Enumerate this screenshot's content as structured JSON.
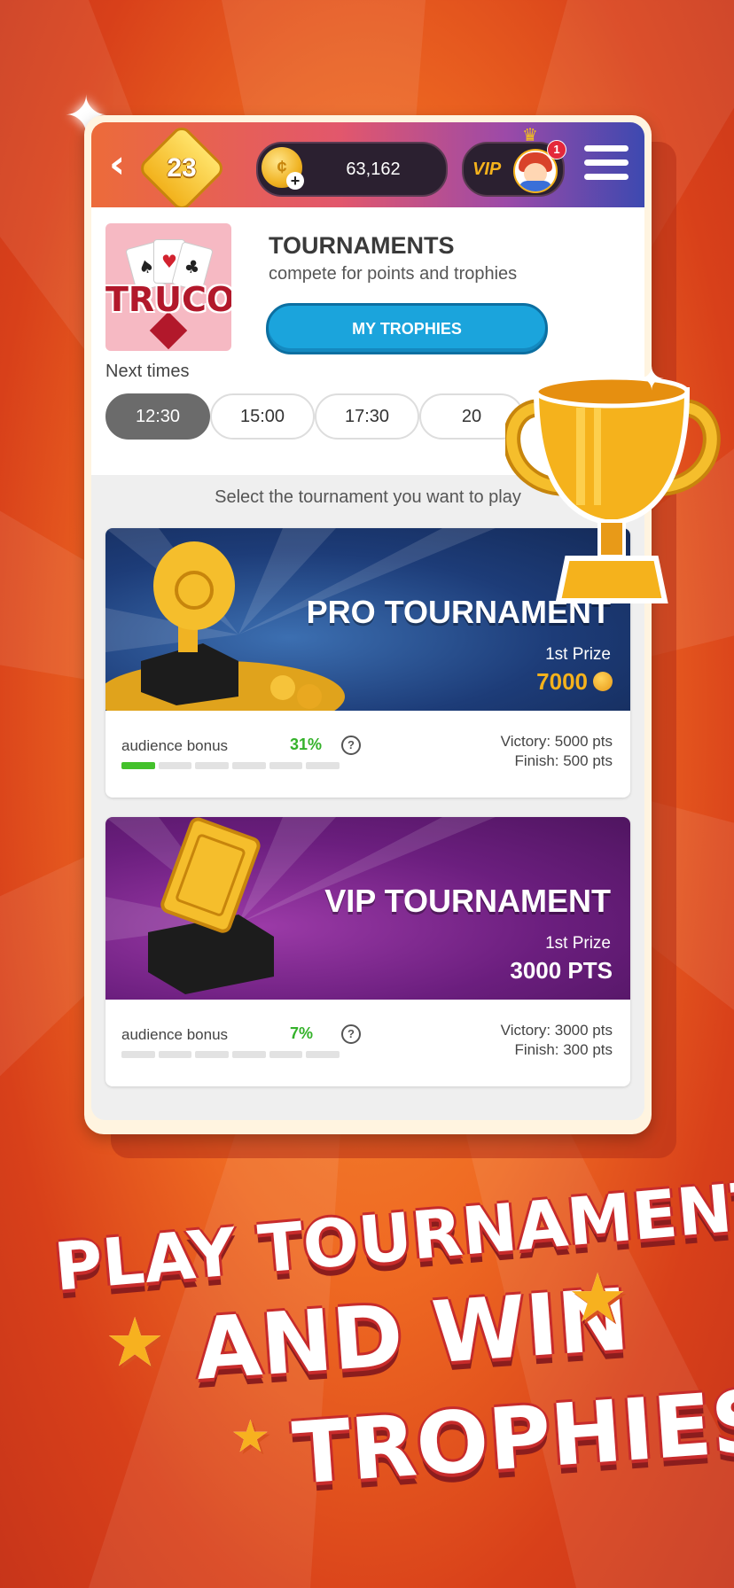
{
  "topbar": {
    "back_icon": "chevron-left-icon",
    "level": "23",
    "coins": "63,162",
    "vip_label": "VIP",
    "notification_count": "1"
  },
  "header": {
    "game_logo_text": "TRUCO",
    "title": "TOURNAMENTS",
    "subtitle": "compete for points and trophies",
    "my_trophies_label": "MY TROPHIES",
    "next_times_label": "Next times",
    "times": [
      "12:30",
      "15:00",
      "17:30",
      "20"
    ],
    "selected_time": "12:30"
  },
  "list": {
    "instruction": "Select the tournament you want to play"
  },
  "tournaments": [
    {
      "name": "PRO TOURNAMENT",
      "prize_label": "1st Prize",
      "prize": "7000",
      "bonus_label": "audience bonus",
      "bonus_pct": "31%",
      "bonus_fraction": 0.31,
      "victory": "Victory: 5000 pts",
      "finish": "Finish: 500 pts"
    },
    {
      "name": "VIP TOURNAMENT",
      "prize_label": "1st Prize",
      "prize": "3000 PTS",
      "bonus_label": "audience bonus",
      "bonus_pct": "7%",
      "bonus_fraction": 0.07,
      "victory": "Victory: 3000 pts",
      "finish": "Finish: 300 pts"
    }
  ],
  "promo": {
    "line1": "PLAY TOURNAMENTS",
    "line2": "AND WIN",
    "line3": "TROPHIES"
  },
  "colors": {
    "background": "#ef6a22",
    "accent_button": "#1ba4dc",
    "bonus_green": "#43c12b",
    "gold": "#f5b21c"
  }
}
